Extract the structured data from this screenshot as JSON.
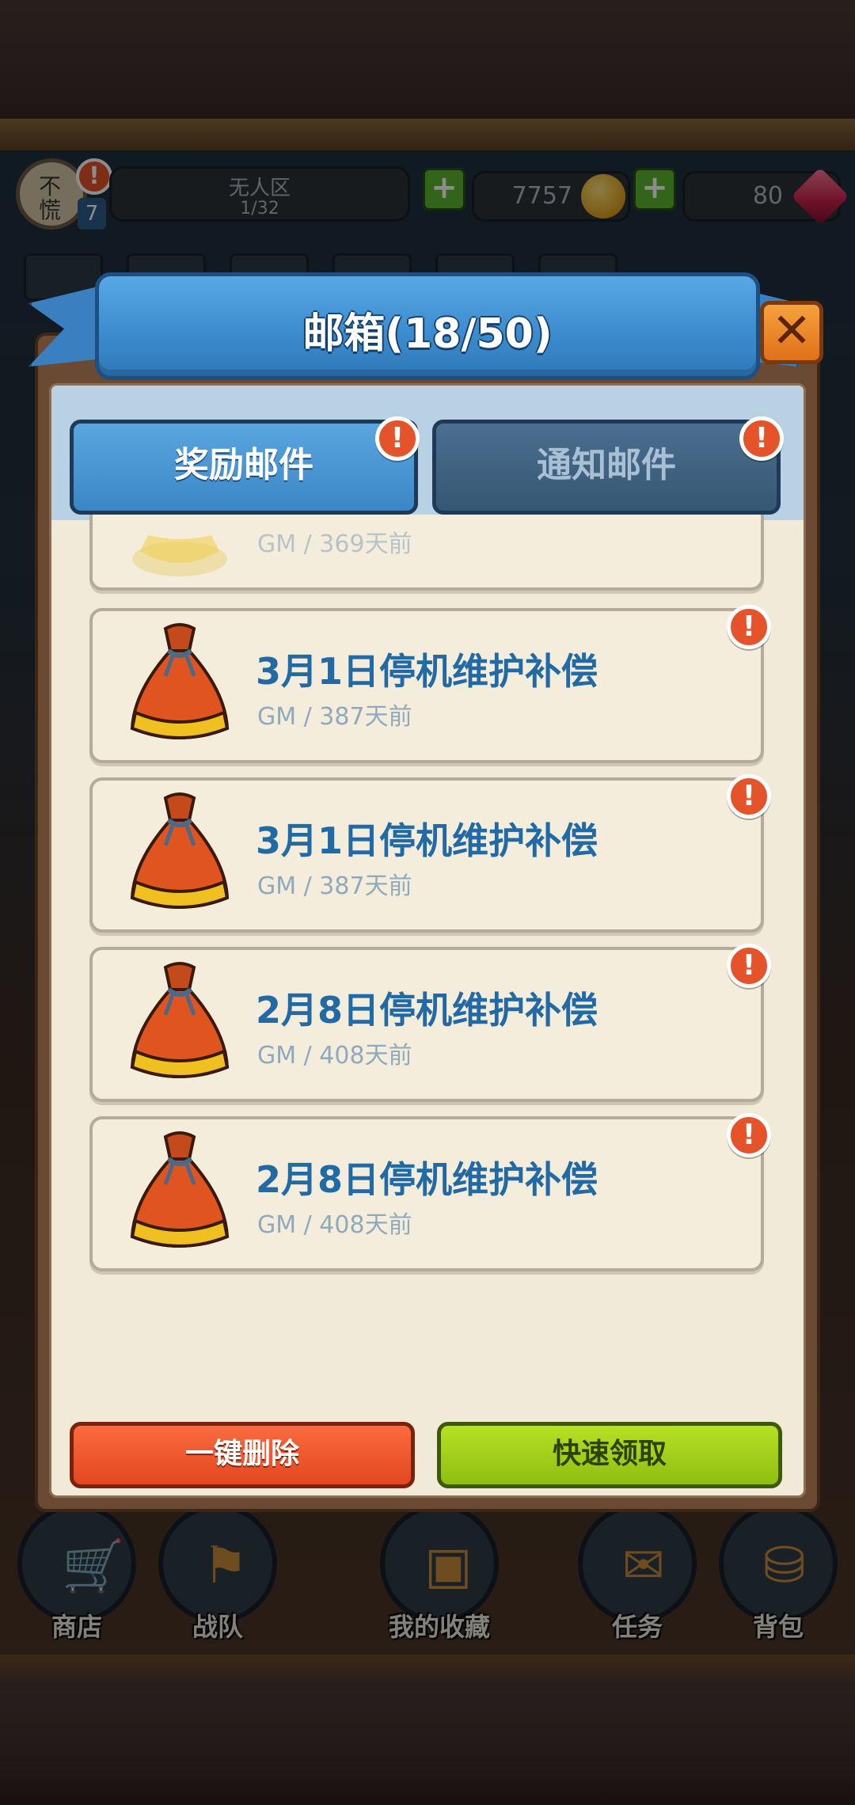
{
  "hud": {
    "avatar_text": "不慌",
    "level": "7",
    "zone_name": "无人区",
    "zone_progress": "1/32",
    "gold": "7757",
    "gems": "80"
  },
  "dialog": {
    "title": "邮箱(18/50)",
    "tabs": {
      "reward": "奖励邮件",
      "notice": "通知邮件"
    },
    "mails": [
      {
        "title": "",
        "meta": "GM / 369天前",
        "unread": false,
        "partial": true
      },
      {
        "title": "3月1日停机维护补偿",
        "meta": "GM / 387天前",
        "unread": true
      },
      {
        "title": "3月1日停机维护补偿",
        "meta": "GM / 387天前",
        "unread": true
      },
      {
        "title": "2月8日停机维护补偿",
        "meta": "GM / 408天前",
        "unread": true
      },
      {
        "title": "2月8日停机维护补偿",
        "meta": "GM / 408天前",
        "unread": true
      }
    ],
    "buttons": {
      "delete_all": "一键删除",
      "quick_claim": "快速领取"
    }
  },
  "nav": {
    "shop": "商店",
    "team": "战队",
    "collection": "我的收藏",
    "quest": "任务",
    "bag": "背包"
  },
  "icons": {
    "close": "close-icon",
    "alert": "exclamation-icon",
    "reward_bag": "reward-bag-icon",
    "coin": "gold-coin-icon",
    "gem": "ruby-gem-icon"
  },
  "colors": {
    "banner_blue": "#3d8dd0",
    "title_blue": "#226aa6",
    "alert_red": "#e5532a",
    "delete_red": "#e2481f",
    "claim_green": "#8fbe12",
    "parchment": "#f1ead9"
  }
}
